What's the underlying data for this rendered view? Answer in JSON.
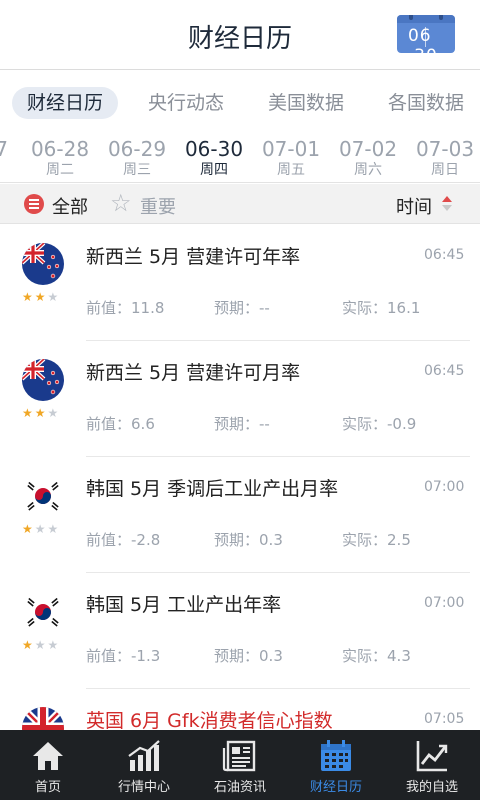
{
  "header": {
    "title": "财经日历",
    "calendar_button": {
      "month": "06",
      "day": "30",
      "icon": "calendar-icon"
    }
  },
  "category_tabs": [
    {
      "label": "财经日历",
      "active": true
    },
    {
      "label": "央行动态",
      "active": false
    },
    {
      "label": "美国数据",
      "active": false
    },
    {
      "label": "各国数据",
      "active": false
    }
  ],
  "dates": {
    "partial_left": "7",
    "items": [
      {
        "date": "06-28",
        "weekday": "周二",
        "active": false
      },
      {
        "date": "06-29",
        "weekday": "周三",
        "active": false
      },
      {
        "date": "06-30",
        "weekday": "周四",
        "active": true
      },
      {
        "date": "07-01",
        "weekday": "周五",
        "active": false
      },
      {
        "date": "07-02",
        "weekday": "周六",
        "active": false
      },
      {
        "date": "07-03",
        "weekday": "周日",
        "active": false
      }
    ]
  },
  "filter": {
    "all_label": "全部",
    "important_label": "重要",
    "time_label": "时间",
    "all_icon": "list-icon",
    "important_icon": "star-outline-icon",
    "sort_icon": "sort-icon"
  },
  "labels": {
    "previous": "前值：",
    "forecast": "预期：",
    "actual": "实际："
  },
  "events": [
    {
      "flag": "new-zealand",
      "stars": 2,
      "name": "新西兰 5月 营建许可年率",
      "time": "06:45",
      "previous": "11.8",
      "forecast": "--",
      "actual": "16.1",
      "highlight": false
    },
    {
      "flag": "new-zealand",
      "stars": 2,
      "name": "新西兰 5月 营建许可月率",
      "time": "06:45",
      "previous": "6.6",
      "forecast": "--",
      "actual": "-0.9",
      "highlight": false
    },
    {
      "flag": "south-korea",
      "stars": 1,
      "name": "韩国 5月 季调后工业产出月率",
      "time": "07:00",
      "previous": "-2.8",
      "forecast": "0.3",
      "actual": "2.5",
      "highlight": false
    },
    {
      "flag": "south-korea",
      "stars": 1,
      "name": "韩国 5月 工业产出年率",
      "time": "07:00",
      "previous": "-1.3",
      "forecast": "0.3",
      "actual": "4.3",
      "highlight": false
    },
    {
      "flag": "united-kingdom",
      "stars": 2,
      "name": "英国 6月 Gfk消费者信心指数",
      "time": "07:05",
      "previous": "",
      "forecast": "",
      "actual": "",
      "highlight": true
    }
  ],
  "tab_bar": [
    {
      "label": "首页",
      "icon": "home-icon",
      "active": false
    },
    {
      "label": "行情中心",
      "icon": "chart-bar-icon",
      "active": false
    },
    {
      "label": "石油资讯",
      "icon": "newspaper-icon",
      "active": false
    },
    {
      "label": "财经日历",
      "icon": "calendar-icon",
      "active": true
    },
    {
      "label": "我的自选",
      "icon": "trend-icon",
      "active": false
    }
  ],
  "colors": {
    "accent": "#3b8be6",
    "highlight_red": "#d22b2b",
    "star": "#f0a726",
    "tabbar_bg": "#1e2124"
  }
}
